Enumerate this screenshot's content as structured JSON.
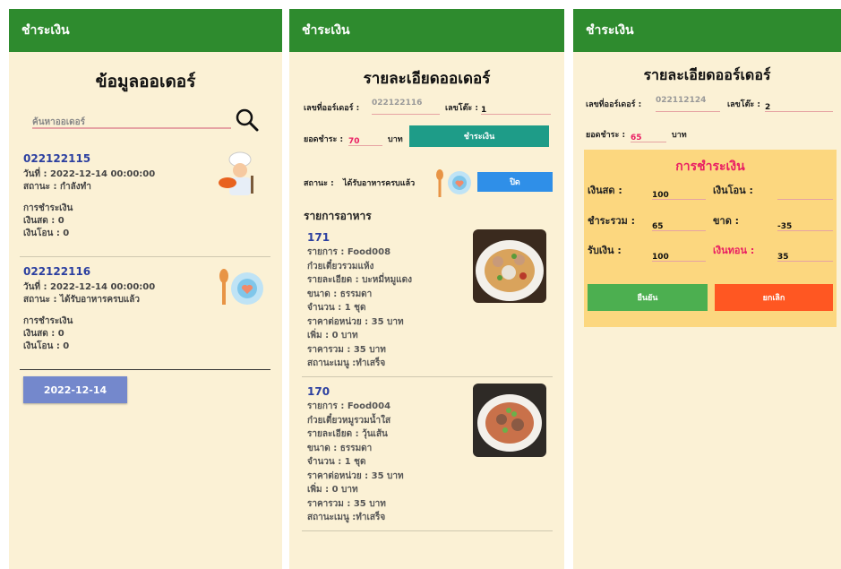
{
  "appbar_title": "ชำระเงิน",
  "screen1": {
    "title": "ข้อมูลออเดอร์",
    "search_placeholder": "ค้นหาออเดอร์",
    "orders": [
      {
        "id": "022122115",
        "date": "วันที่ : 2022-12-14 00:00:00",
        "status": "สถานะ : กำลังทำ",
        "payment_label": "การชำระเงิน",
        "cash": "เงินสด : 0",
        "transfer": "เงินโอน : 0"
      },
      {
        "id": "022122116",
        "date": "วันที่ : 2022-12-14 00:00:00",
        "status": "สถานะ : ได้รับอาหารครบแล้ว",
        "payment_label": "การชำระเงิน",
        "cash": "เงินสด : 0",
        "transfer": "เงินโอน : 0"
      }
    ],
    "date_button": "2022-12-14"
  },
  "screen2": {
    "title": "รายละเอียดออเดอร์",
    "order_no_label": "เลขที่ออร์เดอร์ :",
    "order_no": "022122116",
    "table_label": "เลขโต๊ะ :",
    "table_no": "1",
    "amount_label": "ยอดชำระ :",
    "amount": "70",
    "baht": "บาท",
    "pay_button": "ชำระเงิน",
    "status_label": "สถานะ :",
    "status_value": "ได้รับอาหารครบแล้ว",
    "close_button": "ปิด",
    "items_heading": "รายการอาหาร",
    "items": [
      {
        "id": "171",
        "line1": "รายการ : Food008",
        "line2": "ก๋วยเตี๋ยวรวมแห้ง",
        "line3": "รายละเอียด : บะหมี่หมูแดง",
        "line4": "ขนาด : ธรรมดา",
        "line5": "จำนวน : 1 ชุด",
        "line6": "ราคาต่อหน่วย : 35 บาท",
        "line7": "เพิ่ม : 0 บาท",
        "line8": "ราคารวม : 35  บาท",
        "line9": "สถานะเมนู :ทำเสร็จ"
      },
      {
        "id": "170",
        "line1": "รายการ : Food004",
        "line2": "ก๋วยเตี๋ยวหมูรวมน้ำใส",
        "line3": "รายละเอียด : วุ้นเส้น",
        "line4": "ขนาด : ธรรมดา",
        "line5": "จำนวน : 1 ชุด",
        "line6": "ราคาต่อหน่วย : 35 บาท",
        "line7": "เพิ่ม : 0 บาท",
        "line8": "ราคารวม : 35  บาท",
        "line9": "สถานะเมนู :ทำเสร็จ"
      }
    ]
  },
  "screen3": {
    "title": "รายละเอียดออร์เดอร์",
    "order_no_label": "เลขที่ออร์เดอร์ :",
    "order_no": "022112124",
    "table_label": "เลขโต๊ะ :",
    "table_no": "2",
    "amount_label": "ยอดชำระ :",
    "amount": "65",
    "baht": "บาท",
    "panel_title": "การชำระเงิน",
    "cash_label": "เงินสด :",
    "cash_value": "100",
    "transfer_label": "เงินโอน :",
    "transfer_value": "",
    "total_label": "ชำระรวม :",
    "total_value": "65",
    "short_label": "ขาด :",
    "short_value": "-35",
    "received_label": "รับเงิน :",
    "received_value": "100",
    "change_label": "เงินทอน :",
    "change_value": "35",
    "confirm_button": "ยืนยัน",
    "cancel_button": "ยกเลิก"
  },
  "colors": {
    "appbar": "#2e8b2e",
    "background": "#fbf1d5",
    "order_id": "#2b3fa0",
    "teal_button": "#1e9c88",
    "blue_button": "#2f8fe8",
    "date_button": "#7488cc",
    "confirm": "#4caf50",
    "cancel": "#ff5722",
    "panel": "#fcd77f",
    "accent_pink": "#e91e63"
  }
}
